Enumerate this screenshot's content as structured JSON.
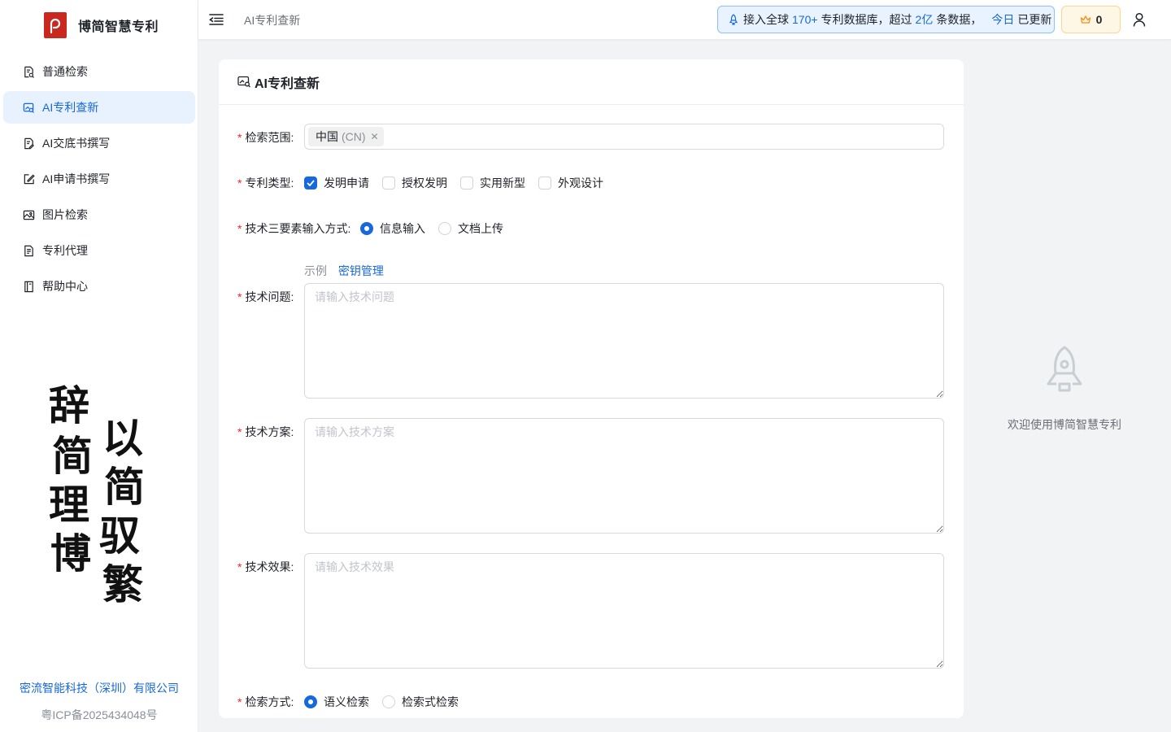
{
  "app": {
    "name": "博简智慧专利"
  },
  "sidebar": {
    "items": [
      {
        "label": "普通检索",
        "icon": "doc-search-icon",
        "active": false
      },
      {
        "label": "AI专利查新",
        "icon": "image-search-icon",
        "active": true
      },
      {
        "label": "AI交底书撰写",
        "icon": "doc-edit-icon",
        "active": false
      },
      {
        "label": "AI申请书撰写",
        "icon": "pen-square-icon",
        "active": false
      },
      {
        "label": "图片检索",
        "icon": "picture-icon",
        "active": false
      },
      {
        "label": "专利代理",
        "icon": "doc-list-icon",
        "active": false
      },
      {
        "label": "帮助中心",
        "icon": "book-icon",
        "active": false
      }
    ],
    "calligraphy": [
      "辞",
      "简",
      "理",
      "博",
      "以",
      "简",
      "驭",
      "繁"
    ],
    "company": "密流智能科技（深圳）有限公司",
    "icp": "粤ICP备2025434048号"
  },
  "header": {
    "title": "AI专利查新",
    "notice": {
      "p1": "接入全球",
      "h1": "170+",
      "p2": "专利数据库，超过",
      "h2": "2亿",
      "p3": "条数据，",
      "h3": "今日",
      "p4": "已更新"
    },
    "coins": "0"
  },
  "form": {
    "card_title": "AI专利查新",
    "scope": {
      "label": "检索范围:",
      "tag": "中国",
      "tag_sub": "(CN)"
    },
    "patent_type": {
      "label": "专利类型:",
      "options": [
        {
          "label": "发明申请",
          "checked": true
        },
        {
          "label": "授权发明",
          "checked": false
        },
        {
          "label": "实用新型",
          "checked": false
        },
        {
          "label": "外观设计",
          "checked": false
        }
      ]
    },
    "input_mode": {
      "label": "技术三要素输入方式:",
      "options": [
        {
          "label": "信息输入",
          "selected": true
        },
        {
          "label": "文档上传",
          "selected": false
        }
      ]
    },
    "links": {
      "example": "示例",
      "key_mgmt": "密钥管理"
    },
    "problem": {
      "label": "技术问题:",
      "placeholder": "请输入技术问题"
    },
    "solution": {
      "label": "技术方案:",
      "placeholder": "请输入技术方案"
    },
    "effect": {
      "label": "技术效果:",
      "placeholder": "请输入技术效果"
    },
    "search_mode": {
      "label": "检索方式:",
      "options": [
        {
          "label": "语义检索",
          "selected": true
        },
        {
          "label": "检索式检索",
          "selected": false
        }
      ]
    }
  },
  "welcome": {
    "text": "欢迎使用博简智慧专利",
    "icon": "rocket-icon"
  },
  "colors": {
    "accent": "#1668dc",
    "brand": "#c8281e",
    "required": "#f5222d"
  }
}
